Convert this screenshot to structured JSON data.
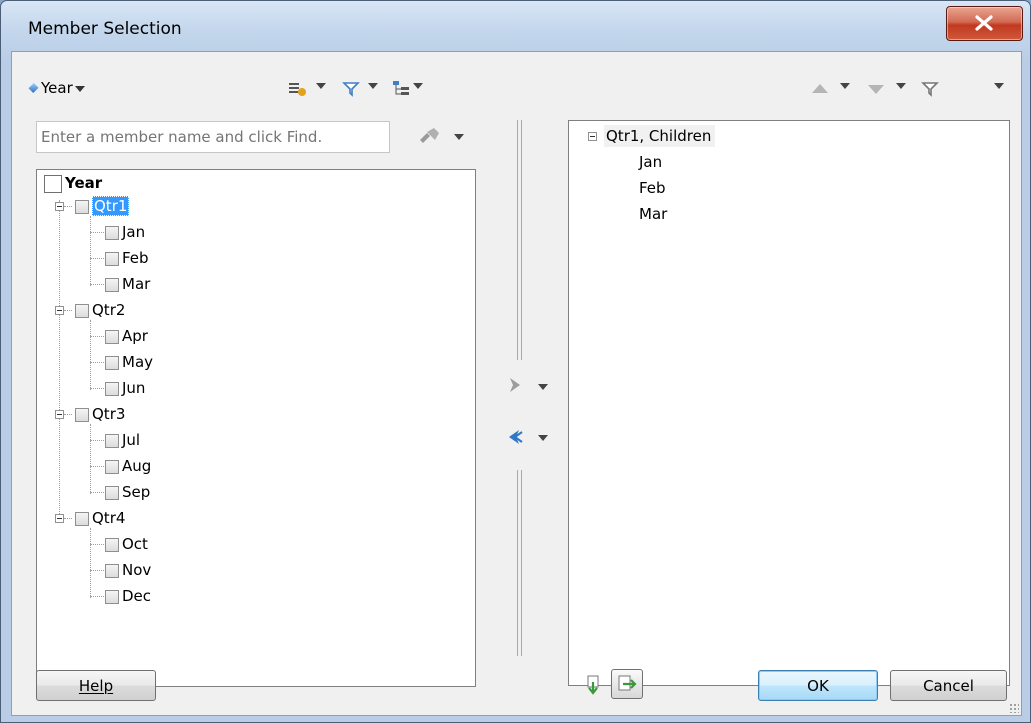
{
  "window": {
    "title": "Member Selection"
  },
  "toolbar_left": {
    "dimension_label": "Year"
  },
  "search": {
    "placeholder": "Enter a member name and click Find."
  },
  "left_tree": {
    "root": "Year",
    "quarters": [
      {
        "label": "Qtr1",
        "months": [
          "Jan",
          "Feb",
          "Mar"
        ]
      },
      {
        "label": "Qtr2",
        "months": [
          "Apr",
          "May",
          "Jun"
        ]
      },
      {
        "label": "Qtr3",
        "months": [
          "Jul",
          "Aug",
          "Sep"
        ]
      },
      {
        "label": "Qtr4",
        "months": [
          "Oct",
          "Nov",
          "Dec"
        ]
      }
    ]
  },
  "right_tree": {
    "header": "Qtr1, Children",
    "items": [
      "Jan",
      "Feb",
      "Mar"
    ]
  },
  "buttons": {
    "help": "Help",
    "ok": "OK",
    "cancel": "Cancel"
  }
}
